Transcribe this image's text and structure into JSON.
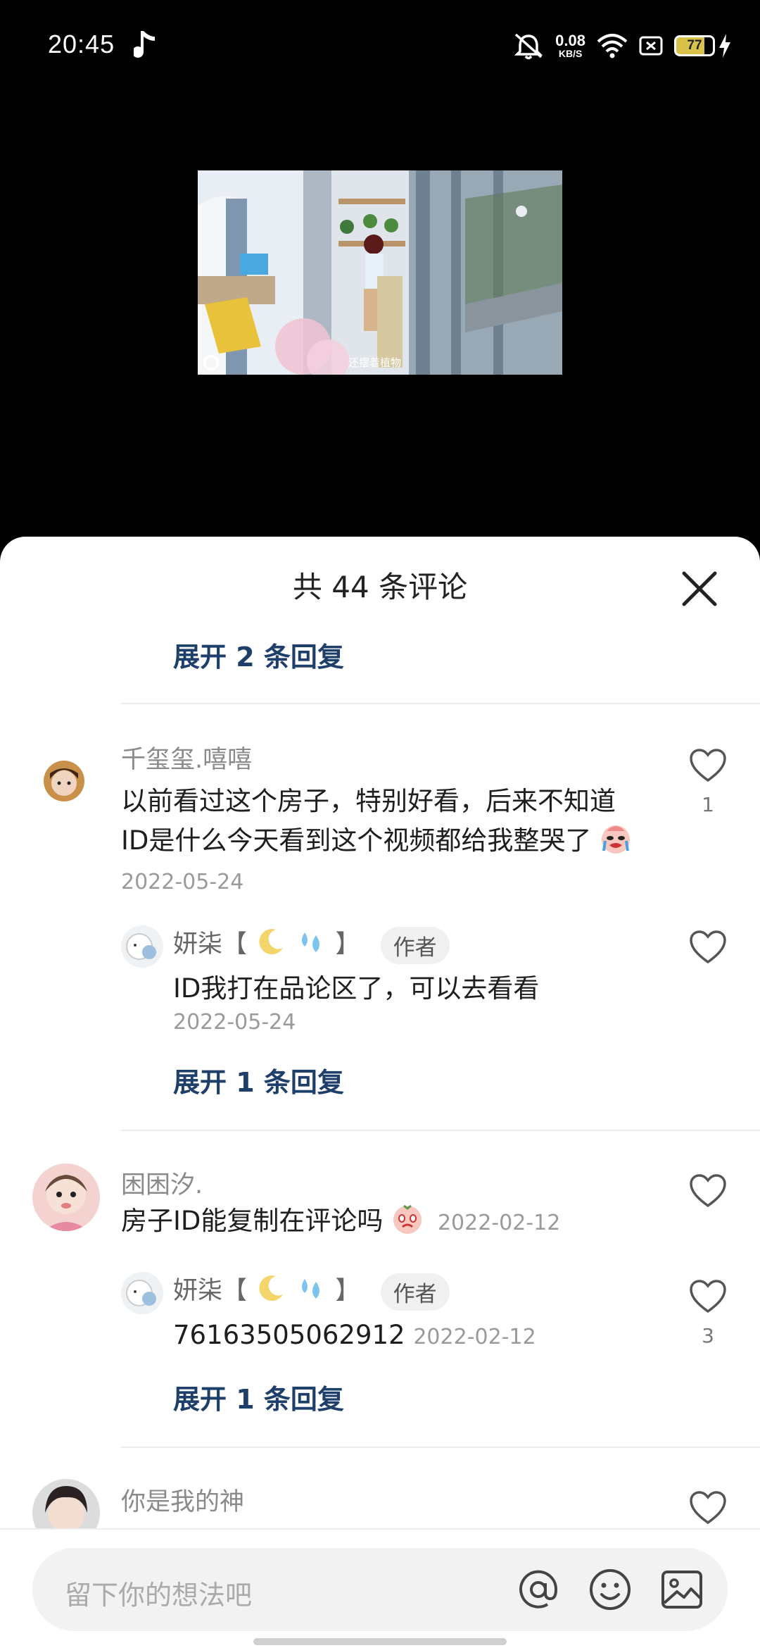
{
  "status_bar": {
    "time": "20:45",
    "net_speed_value": "0.08",
    "net_speed_unit": "KB/S",
    "battery": "77",
    "icons": [
      "music-icon",
      "mute-icon",
      "wifi-icon",
      "sim-icon",
      "battery-icon",
      "charging-icon"
    ]
  },
  "video": {
    "caption": "还摆着植物"
  },
  "sheet": {
    "title": "共 44 条评论",
    "top_expand": "展开 2 条回复",
    "comments": [
      {
        "username": "千玺玺.嘻嘻",
        "text": "以前看过这个房子，特别好看，后来不知道ID是什么今天看到这个视频都给我整哭了",
        "date": "2022-05-24",
        "likes": "1",
        "reply": {
          "username": "妍柒【",
          "username_end": "】",
          "badge": "作者",
          "text": "ID我打在品论区了，可以去看看",
          "date": "2022-05-24"
        },
        "expand": "展开 1 条回复"
      },
      {
        "username": "困困汐.",
        "text": "房子ID能复制在评论吗",
        "date": "2022-02-12",
        "reply": {
          "username": "妍柒【",
          "username_end": "】",
          "badge": "作者",
          "text": "76163505062912",
          "date": "2022-02-12",
          "likes": "3"
        },
        "expand": "展开 1 条回复"
      },
      {
        "username": "你是我的神"
      }
    ]
  },
  "input": {
    "placeholder": "留下你的想法吧"
  }
}
